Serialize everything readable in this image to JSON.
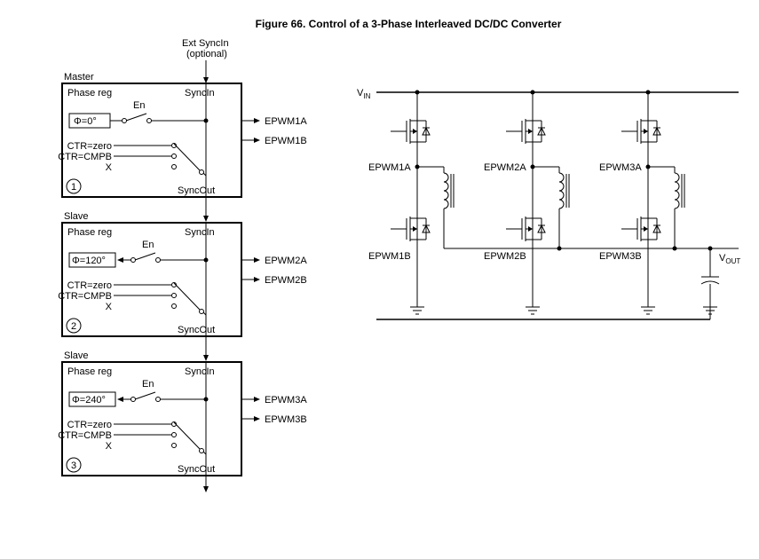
{
  "figure_title": "Figure 66. Control of a 3-Phase Interleaved DC/DC Converter",
  "ext_sync_label1": "Ext SyncIn",
  "ext_sync_label2": "(optional)",
  "modules": [
    {
      "role": "Master",
      "phase_reg": "Phase reg",
      "sync_in": "SyncIn",
      "sync_out": "SyncOut",
      "en": "En",
      "phi": "Φ=0°",
      "ctr_zero": "CTR=zero",
      "ctr_cmpb": "CTR=CMPB",
      "x": "X",
      "index": "1",
      "outA": "EPWM1A",
      "outB": "EPWM1B"
    },
    {
      "role": "Slave",
      "phase_reg": "Phase reg",
      "sync_in": "SyncIn",
      "sync_out": "SyncOut",
      "en": "En",
      "phi": "Φ=120°",
      "ctr_zero": "CTR=zero",
      "ctr_cmpb": "CTR=CMPB",
      "x": "X",
      "index": "2",
      "outA": "EPWM2A",
      "outB": "EPWM2B"
    },
    {
      "role": "Slave",
      "phase_reg": "Phase reg",
      "sync_in": "SyncIn",
      "sync_out": "SyncOut",
      "en": "En",
      "phi": "Φ=240°",
      "ctr_zero": "CTR=zero",
      "ctr_cmpb": "CTR=CMPB",
      "x": "X",
      "index": "3",
      "outA": "EPWM3A",
      "outB": "EPWM3B"
    }
  ],
  "vin": "V",
  "vin_sub": "IN",
  "vout": "V",
  "vout_sub": "OUT",
  "legs": [
    {
      "A": "EPWM1A",
      "B": "EPWM1B"
    },
    {
      "A": "EPWM2A",
      "B": "EPWM2B"
    },
    {
      "A": "EPWM3A",
      "B": "EPWM3B"
    }
  ]
}
